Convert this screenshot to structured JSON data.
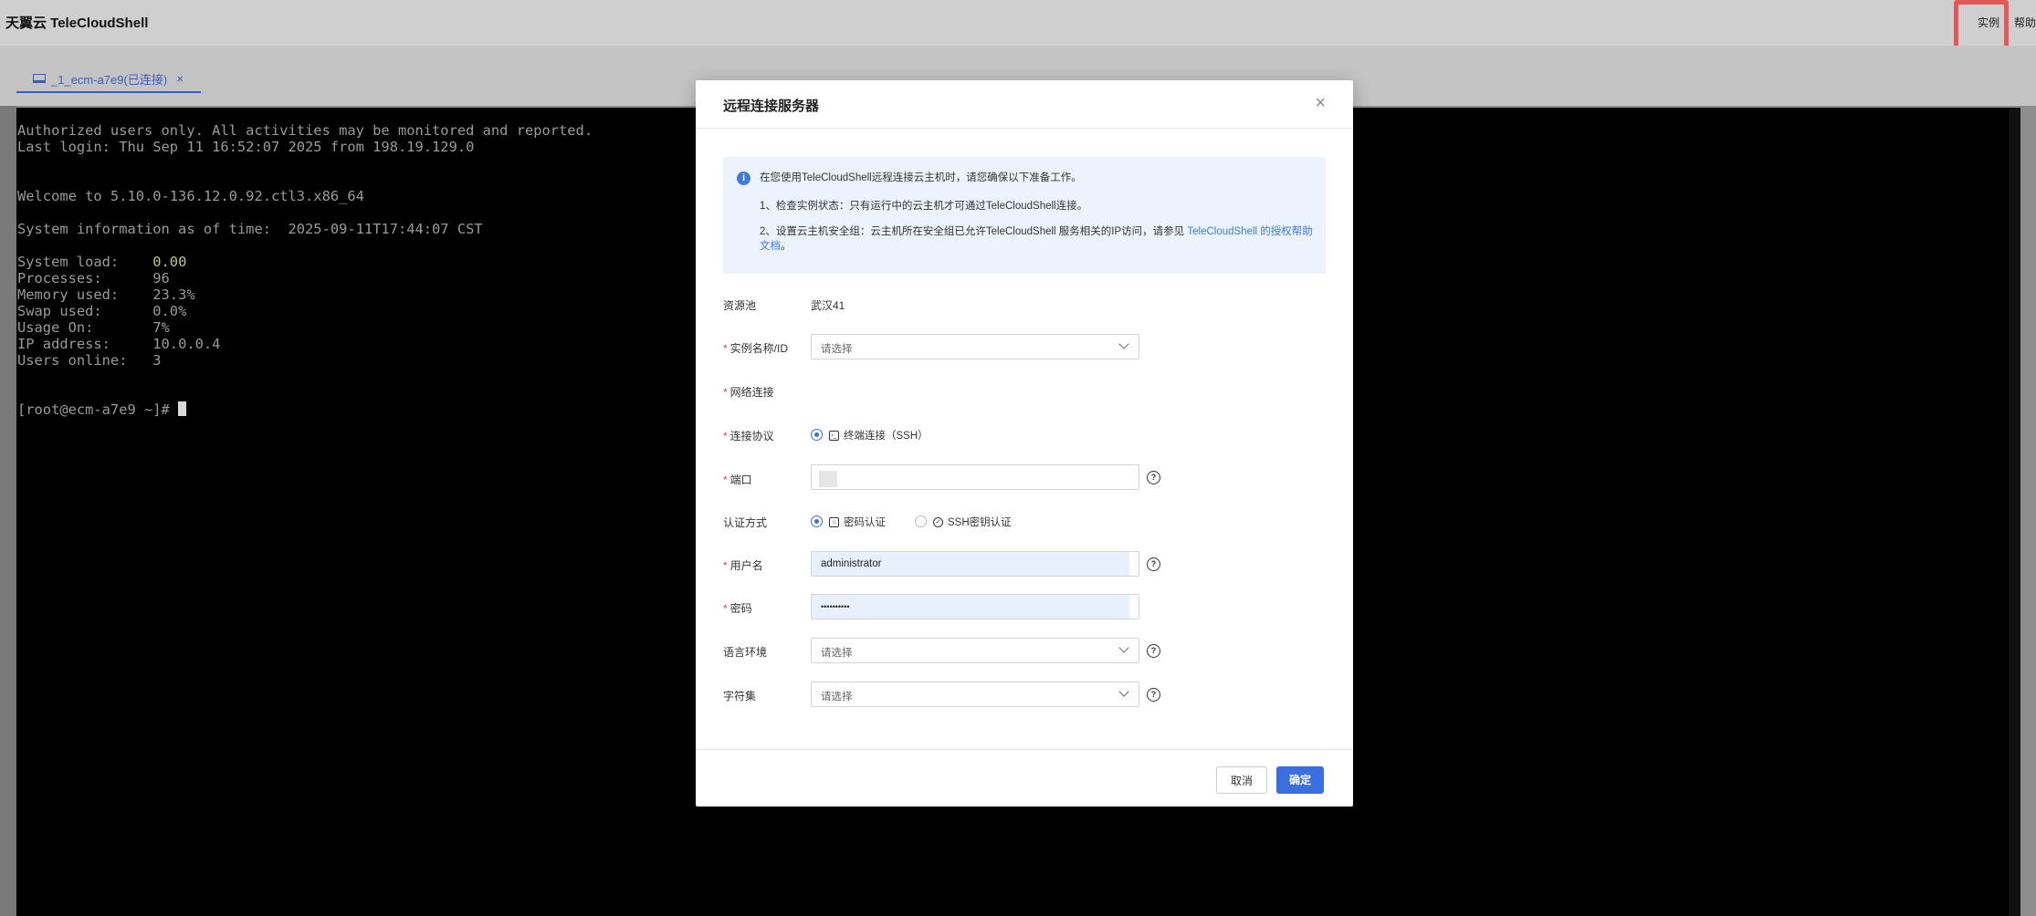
{
  "app": {
    "title": "天翼云 TeleCloudShell"
  },
  "header": {
    "links": [
      "实例",
      "帮助"
    ]
  },
  "tabs": [
    {
      "label": "_1_ecm-a7e9(已连接)",
      "close": "×"
    }
  ],
  "terminal": {
    "lines": [
      "Authorized users only. All activities may be monitored and reported.",
      "Last login: Thu Sep 11 16:52:07 2025 from 198.19.129.0",
      "",
      "",
      "Welcome to 5.10.0-136.12.0.92.ctl3.x86_64",
      "",
      "System information as of time:  2025-09-11T17:44:07 CST"
    ],
    "stats": [
      {
        "label": "System load:    ",
        "value": "0.00"
      },
      {
        "label": "Processes:      ",
        "value": "96"
      },
      {
        "label": "Memory used:    ",
        "value": "23.3%"
      },
      {
        "label": "Swap used:      ",
        "value": "0.0%"
      },
      {
        "label": "Usage On:       ",
        "value": "7%"
      },
      {
        "label": "IP address:     ",
        "value": "10.0.0.4"
      },
      {
        "label": "Users online:   ",
        "value": "3"
      }
    ],
    "prompt": "[root@ecm-a7e9 ~]# "
  },
  "modal": {
    "title": "远程连接服务器",
    "notice": {
      "intro": "在您使用TeleCloudShell远程连接云主机时，请您确保以下准备工作。",
      "item1": "1、检查实例状态：只有运行中的云主机才可通过TeleCloudShell连接。",
      "item2_text": "2、设置云主机安全组：云主机所在安全组已允许TeleCloudShell 服务相关的IP访问，请参见 ",
      "item2_link": "TeleCloudShell 的授权帮助",
      "item2_link2": "文档",
      "item2_end": "。"
    },
    "form": {
      "pool_label": "资源池",
      "pool_value": "武汉41",
      "instance_label": "实例名称/ID",
      "instance_placeholder": "请选择",
      "network_label": "网络连接",
      "protocol_label": "连接协议",
      "protocol_option": "终端连接（SSH）",
      "port_label": "端口",
      "auth_label": "认证方式",
      "auth_password": "密码认证",
      "auth_key": "SSH密钥认证",
      "username_label": "用户名",
      "username_value": "administrator",
      "password_label": "密码",
      "password_value": "••••••••••",
      "locale_label": "语言环境",
      "locale_placeholder": "请选择",
      "charset_label": "字符集",
      "charset_placeholder": "请选择"
    },
    "buttons": {
      "cancel": "取消",
      "ok": "确定"
    }
  },
  "colors": {
    "accent": "#3b6fe0",
    "highlight": "#e5585a",
    "required": "#e0474b"
  }
}
